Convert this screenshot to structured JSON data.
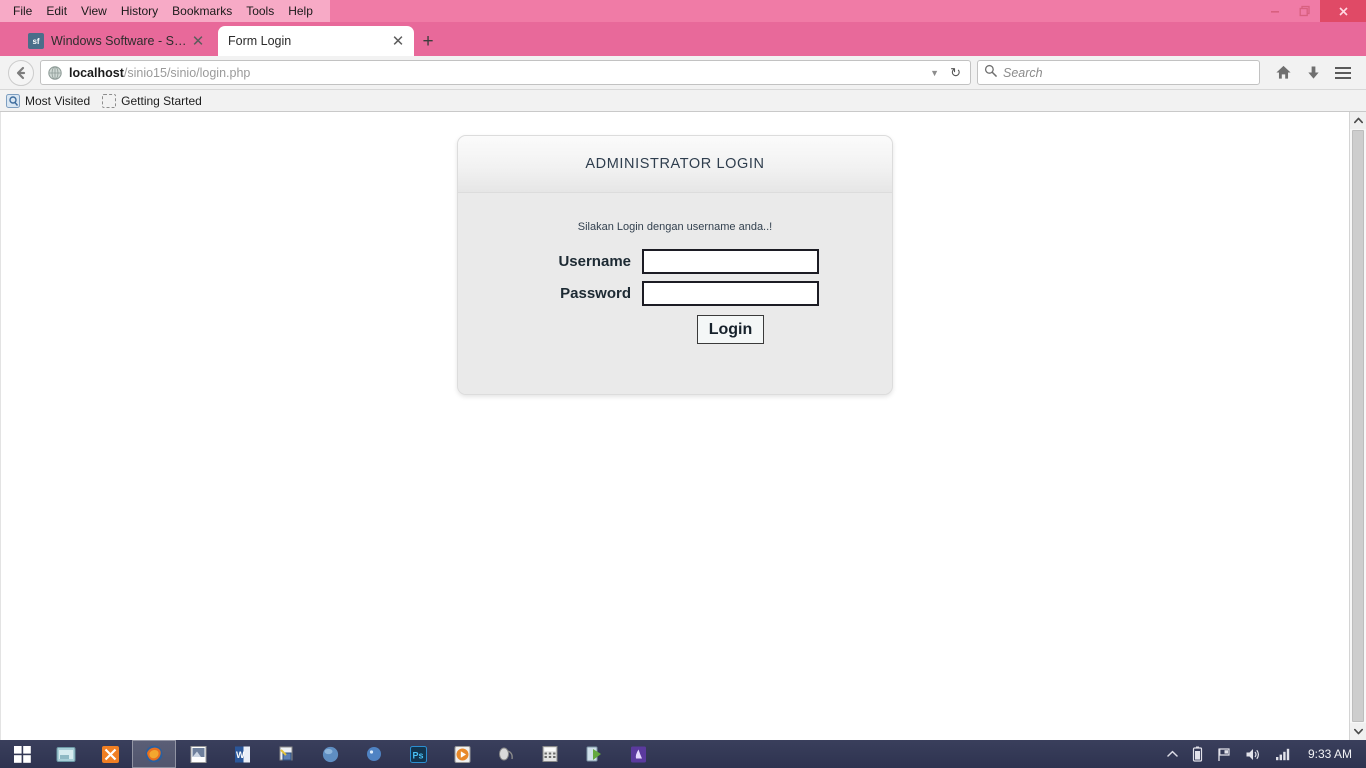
{
  "browser": {
    "menu": [
      {
        "label": "File",
        "accel": "F"
      },
      {
        "label": "Edit",
        "accel": "E"
      },
      {
        "label": "View",
        "accel": "V"
      },
      {
        "label": "History",
        "accel": "s"
      },
      {
        "label": "Bookmarks",
        "accel": "B"
      },
      {
        "label": "Tools",
        "accel": "T"
      },
      {
        "label": "Help",
        "accel": "H"
      }
    ],
    "window_controls": {
      "minimize": "minimize-icon",
      "restore": "restore-icon",
      "close": "close-icon"
    },
    "tabs": [
      {
        "title": "Windows Software - Sourc...",
        "favicon": "sf",
        "active": false
      },
      {
        "title": "Form Login",
        "favicon": "globe-icon",
        "active": true
      }
    ],
    "new_tab_label": "+",
    "toolbar": {
      "back_icon": "back-arrow-icon",
      "url_bold": "localhost",
      "url_rest": "/sinio15/sinio/login.php",
      "url_full": "localhost/sinio15/sinio/login.php",
      "dropdown_icon": "chevron-down-icon",
      "reload_icon": "reload-icon",
      "search_placeholder": "Search",
      "search_value": "",
      "home_icon": "home-icon",
      "downloads_icon": "download-icon",
      "menu_icon": "hamburger-menu-icon"
    },
    "bookmarks": [
      {
        "label": "Most Visited",
        "icon": "most-visited-icon"
      },
      {
        "label": "Getting Started",
        "icon": "placeholder-icon"
      }
    ]
  },
  "page": {
    "card": {
      "title": "ADMINISTRATOR LOGIN",
      "subtitle": "Silakan Login dengan username anda..!",
      "fields": [
        {
          "label": "Username",
          "name": "username",
          "type": "text",
          "value": "",
          "placeholder": ""
        },
        {
          "label": "Password",
          "name": "password",
          "type": "password",
          "value": "",
          "placeholder": ""
        }
      ],
      "submit_label": "Login"
    }
  },
  "scrollbar": {
    "up_arrow": "scroll-up-icon",
    "down_arrow": "scroll-down-icon"
  },
  "taskbar": {
    "start_label": "start-button",
    "items": [
      {
        "name": "file-explorer",
        "color": "#7fb6c4"
      },
      {
        "name": "app-orange",
        "color": "#e8812a"
      },
      {
        "name": "firefox",
        "color": "#e6641f",
        "active": true
      },
      {
        "name": "media-player",
        "color": "#d8d8d8"
      },
      {
        "name": "word",
        "color": "#2b579a"
      },
      {
        "name": "network-tool",
        "color": "#bdbdbd"
      },
      {
        "name": "blue-sphere",
        "color": "#5b86b8"
      },
      {
        "name": "blue-app",
        "color": "#4f83c3"
      },
      {
        "name": "photoshop",
        "color": "#2a6a9e"
      },
      {
        "name": "orange-player",
        "color": "#e08b2a"
      },
      {
        "name": "mouse-app",
        "color": "#c9c9c9"
      },
      {
        "name": "calculator",
        "color": "#cfcfcf"
      },
      {
        "name": "recycle-app",
        "color": "#6fa84f"
      },
      {
        "name": "purple-app",
        "color": "#5b3a9e"
      }
    ],
    "tray": {
      "show_hidden": "show-hidden-icons",
      "battery": "battery-icon",
      "action_center": "flag-icon",
      "volume": "speaker-icon",
      "network": "signal-bars-icon",
      "clock": "9:33 AM"
    }
  },
  "colors": {
    "accent_pink": "#e8699a",
    "menubar_pink": "#f7aac6",
    "close_red": "#e04a66",
    "taskbar": "#2e3350",
    "card_bg": "#eaeaea",
    "title_text": "#2f3e4e"
  }
}
